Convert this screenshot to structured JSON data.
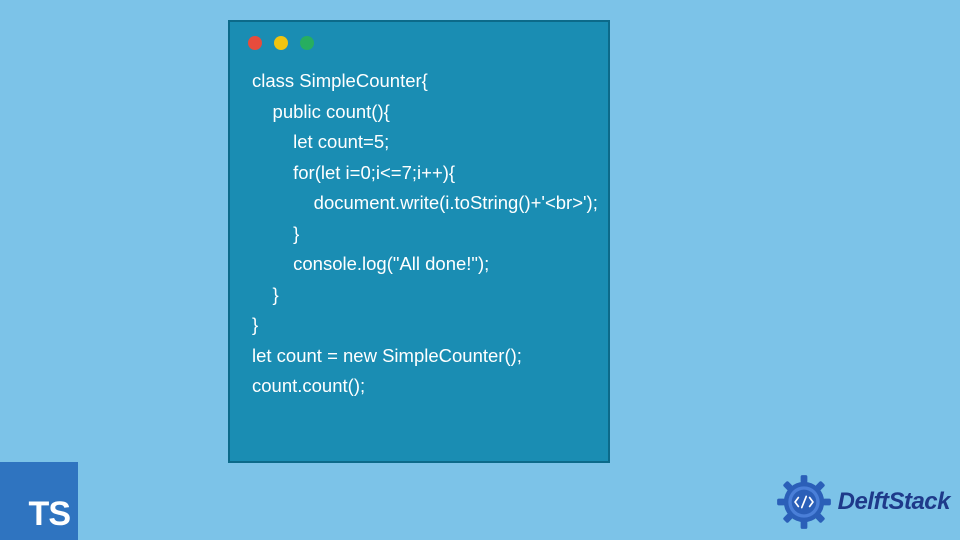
{
  "code": {
    "lines": [
      "class SimpleCounter{",
      "    public count(){",
      "        let count=5;",
      "        for(let i=0;i<=7;i++){",
      "            document.write(i.toString()+'<br>');",
      "        }",
      "        console.log(\"All done!\");",
      "    }",
      "}",
      "let count = new SimpleCounter();",
      "count.count();"
    ]
  },
  "ts_badge": {
    "label": "TS"
  },
  "delft": {
    "brand": "DelftStack"
  }
}
